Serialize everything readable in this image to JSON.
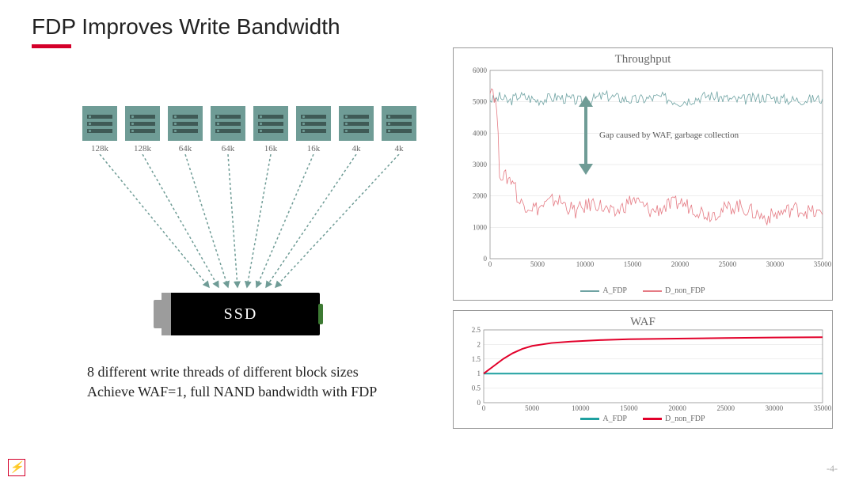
{
  "title": "FDP Improves Write Bandwidth",
  "servers": [
    "128k",
    "128k",
    "64k",
    "64k",
    "16k",
    "16k",
    "4k",
    "4k"
  ],
  "ssd_label": "SSD",
  "caption_line1": "8 different write threads of different block sizes",
  "caption_line2": "Achieve WAF=1, full NAND bandwidth with FDP",
  "annotation": "Gap caused by WAF, garbage collection",
  "page": "-4-",
  "throughput_chart": {
    "title": "Throughput",
    "legend": [
      "A_FDP",
      "D_non_FDP"
    ],
    "colors": {
      "A_FDP": "#6fa3a3",
      "D_non_FDP": "#e57b84"
    }
  },
  "waf_chart": {
    "title": "WAF",
    "legend": [
      "A_FDP",
      "D_non_FDP"
    ],
    "colors": {
      "A_FDP": "#1fa0a0",
      "D_non_FDP": "#e2002a"
    }
  },
  "chart_data": [
    {
      "type": "line",
      "title": "Throughput",
      "xlabel": "",
      "ylabel": "",
      "xlim": [
        0,
        35000
      ],
      "ylim": [
        0,
        6000
      ],
      "xticks": [
        0,
        5000,
        10000,
        15000,
        20000,
        25000,
        30000,
        35000
      ],
      "yticks": [
        0,
        1000,
        2000,
        3000,
        4000,
        5000,
        6000
      ],
      "annotation": "Gap caused by WAF, garbage collection",
      "series": [
        {
          "name": "A_FDP",
          "note": "noisy band roughly constant ~4900–5300",
          "values": [
            {
              "x": 0,
              "y": 5100
            },
            {
              "x": 500,
              "y": 5050
            },
            {
              "x": 1000,
              "y": 5150
            },
            {
              "x": 2000,
              "y": 5000
            },
            {
              "x": 3000,
              "y": 5200
            },
            {
              "x": 5000,
              "y": 5050
            },
            {
              "x": 7000,
              "y": 5150
            },
            {
              "x": 10000,
              "y": 5000
            },
            {
              "x": 12000,
              "y": 5200
            },
            {
              "x": 15000,
              "y": 5050
            },
            {
              "x": 18000,
              "y": 5150
            },
            {
              "x": 20000,
              "y": 5000
            },
            {
              "x": 23000,
              "y": 5200
            },
            {
              "x": 26000,
              "y": 5050
            },
            {
              "x": 29000,
              "y": 5150
            },
            {
              "x": 32000,
              "y": 5050
            },
            {
              "x": 35000,
              "y": 5100
            }
          ]
        },
        {
          "name": "D_non_FDP",
          "note": "starts ~5500, drops to ~2600 then settles noisy band ~1200–2000",
          "values": [
            {
              "x": 0,
              "y": 5500
            },
            {
              "x": 300,
              "y": 5400
            },
            {
              "x": 700,
              "y": 4800
            },
            {
              "x": 1000,
              "y": 2800
            },
            {
              "x": 1500,
              "y": 2600
            },
            {
              "x": 2500,
              "y": 2500
            },
            {
              "x": 3000,
              "y": 1800
            },
            {
              "x": 4000,
              "y": 1700
            },
            {
              "x": 5000,
              "y": 1600
            },
            {
              "x": 7000,
              "y": 1900
            },
            {
              "x": 9000,
              "y": 1500
            },
            {
              "x": 11000,
              "y": 1800
            },
            {
              "x": 13000,
              "y": 1400
            },
            {
              "x": 15000,
              "y": 1900
            },
            {
              "x": 17000,
              "y": 1500
            },
            {
              "x": 20000,
              "y": 1800
            },
            {
              "x": 23000,
              "y": 1400
            },
            {
              "x": 26000,
              "y": 1700
            },
            {
              "x": 29000,
              "y": 1300
            },
            {
              "x": 32000,
              "y": 1600
            },
            {
              "x": 35000,
              "y": 1400
            }
          ]
        }
      ]
    },
    {
      "type": "line",
      "title": "WAF",
      "xlabel": "",
      "ylabel": "",
      "xlim": [
        0,
        35000
      ],
      "ylim": [
        0,
        2.5
      ],
      "xticks": [
        0,
        5000,
        10000,
        15000,
        20000,
        25000,
        30000,
        35000
      ],
      "yticks": [
        0,
        0.5,
        1,
        1.5,
        2,
        2.5
      ],
      "series": [
        {
          "name": "A_FDP",
          "note": "constant at 1",
          "values": [
            {
              "x": 0,
              "y": 1
            },
            {
              "x": 5000,
              "y": 1
            },
            {
              "x": 10000,
              "y": 1
            },
            {
              "x": 15000,
              "y": 1
            },
            {
              "x": 20000,
              "y": 1
            },
            {
              "x": 25000,
              "y": 1
            },
            {
              "x": 30000,
              "y": 1
            },
            {
              "x": 35000,
              "y": 1
            }
          ]
        },
        {
          "name": "D_non_FDP",
          "note": "rises from 1 towards ~2.25 asymptote",
          "values": [
            {
              "x": 0,
              "y": 1.0
            },
            {
              "x": 1000,
              "y": 1.25
            },
            {
              "x": 2000,
              "y": 1.5
            },
            {
              "x": 3000,
              "y": 1.7
            },
            {
              "x": 4000,
              "y": 1.85
            },
            {
              "x": 5000,
              "y": 1.95
            },
            {
              "x": 7000,
              "y": 2.05
            },
            {
              "x": 9000,
              "y": 2.1
            },
            {
              "x": 12000,
              "y": 2.15
            },
            {
              "x": 15000,
              "y": 2.18
            },
            {
              "x": 20000,
              "y": 2.2
            },
            {
              "x": 25000,
              "y": 2.22
            },
            {
              "x": 30000,
              "y": 2.24
            },
            {
              "x": 35000,
              "y": 2.25
            }
          ]
        }
      ]
    }
  ]
}
